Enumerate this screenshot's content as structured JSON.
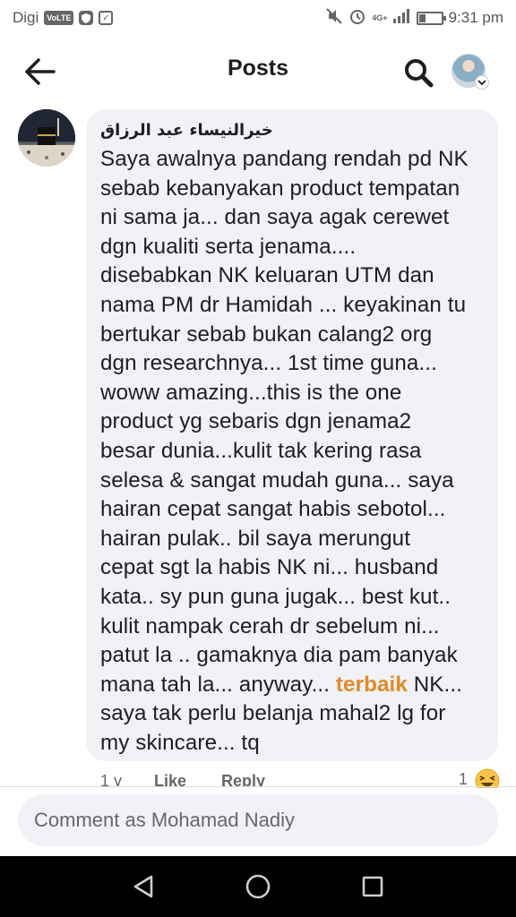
{
  "status_bar": {
    "carrier": "Digi",
    "volte_badge": "VoLTE",
    "network_label": "4G+",
    "time": "9:31 pm",
    "battery_level": 0.3
  },
  "header": {
    "title": "Posts",
    "back_icon": "arrow-left-icon",
    "search_icon": "search-icon",
    "profile_icon": "avatar"
  },
  "comment": {
    "author": "خيرالنيساء عبد الرزاق",
    "lines": [
      "Saya awalnya pandang rendah pd NK",
      "sebab kebanyakan product tempatan",
      "ni sama ja... dan saya agak cerewet",
      "dgn kualiti serta jenama....",
      "disebabkan NK keluaran UTM dan",
      "nama PM dr Hamidah ... keyakinan tu",
      "bertukar sebab bukan calang2 org",
      "dgn researchnya... 1st time guna...",
      "woww amazing...this is the one",
      "product yg sebaris dgn jenama2",
      "besar dunia...kulit tak kering rasa",
      "selesa & sangat mudah guna... saya",
      "hairan cepat sangat habis sebotol...",
      "hairan pulak.. bil saya merungut",
      "cepat sgt la habis NK ni... husband",
      "kata.. sy pun guna jugak... best kut..",
      "kulit nampak cerah dr sebelum ni...",
      "patut la .. gamaknya dia pam banyak"
    ],
    "line19_before": "mana tah la... anyway... ",
    "line19_highlight": "terbaik",
    "line19_after": " NK...",
    "lines_end": [
      "saya tak perlu belanja mahal2 lg for",
      "my skincare... tq"
    ],
    "time_ago": "1 y",
    "like_label": "Like",
    "reply_label": "Reply",
    "reaction_count": "1",
    "reaction_icon": "laughing-emoji-icon",
    "highlight_color": "#e28a27"
  },
  "composer": {
    "placeholder": "Comment as Mohamad Nadiy"
  },
  "nav": {
    "back_icon": "triangle-back-icon",
    "home_icon": "circle-home-icon",
    "recents_icon": "square-recents-icon"
  }
}
